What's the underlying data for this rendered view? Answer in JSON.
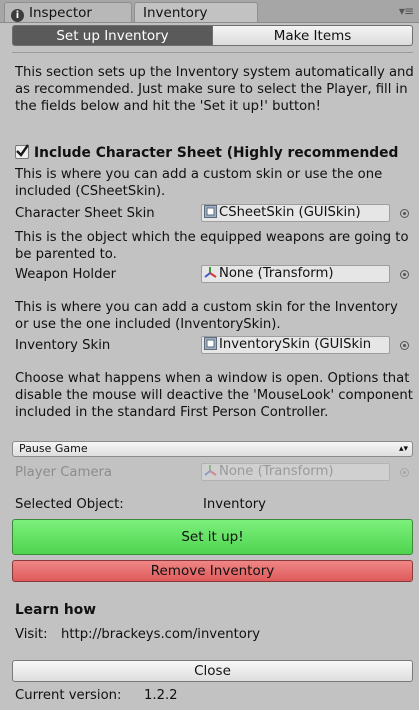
{
  "tabs": [
    {
      "label": "Inspector",
      "icon": "info-icon"
    },
    {
      "label": "Inventory"
    }
  ],
  "toolbar": {
    "setup_label": "Set up Inventory",
    "make_items_label": "Make Items"
  },
  "intro_text": "This section sets up the Inventory system automatically and as recommended. Just make sure to select the Player, fill in the fields below and hit the 'Set it up!' button!",
  "include_sheet": {
    "label": "Include Character Sheet (Highly recommended",
    "checked": true
  },
  "sheet_skin": {
    "help": "This is where you can add a custom skin or use the one included (CSheetSkin).",
    "label": "Character Sheet Skin",
    "value": "CSheetSkin (GUISkin)",
    "icon": "guiskin-icon"
  },
  "weapon_holder": {
    "help": "This is the object which the equipped weapons are going to be parented to.",
    "label": "Weapon Holder",
    "value": "None (Transform)",
    "icon": "transform-icon"
  },
  "inventory_skin": {
    "help": "This is where you can add a custom skin for the Inventory or use the one included (InventorySkin).",
    "label": "Inventory Skin",
    "value": "InventorySkin (GUISkin",
    "icon": "guiskin-icon"
  },
  "window_open": {
    "help": "Choose what happens when a window is open. Options that disable the mouse will deactive the 'MouseLook' component included in the standard First Person Controller.",
    "selected": "Pause Game"
  },
  "player_camera": {
    "label": "Player Camera",
    "value": "None (Transform)",
    "icon": "transform-icon",
    "disabled": true
  },
  "selected_object": {
    "label": "Selected Object:",
    "value": "Inventory"
  },
  "setup_button": {
    "label": "Set it up!",
    "color": "#5ee35e"
  },
  "remove_button": {
    "label": "Remove Inventory",
    "color": "#e96868"
  },
  "learn": {
    "heading": "Learn how",
    "visit_label": "Visit:",
    "url": "http://brackeys.com/inventory"
  },
  "close_button": {
    "label": "Close"
  },
  "version": {
    "label": "Current version:",
    "value": "1.2.2"
  }
}
